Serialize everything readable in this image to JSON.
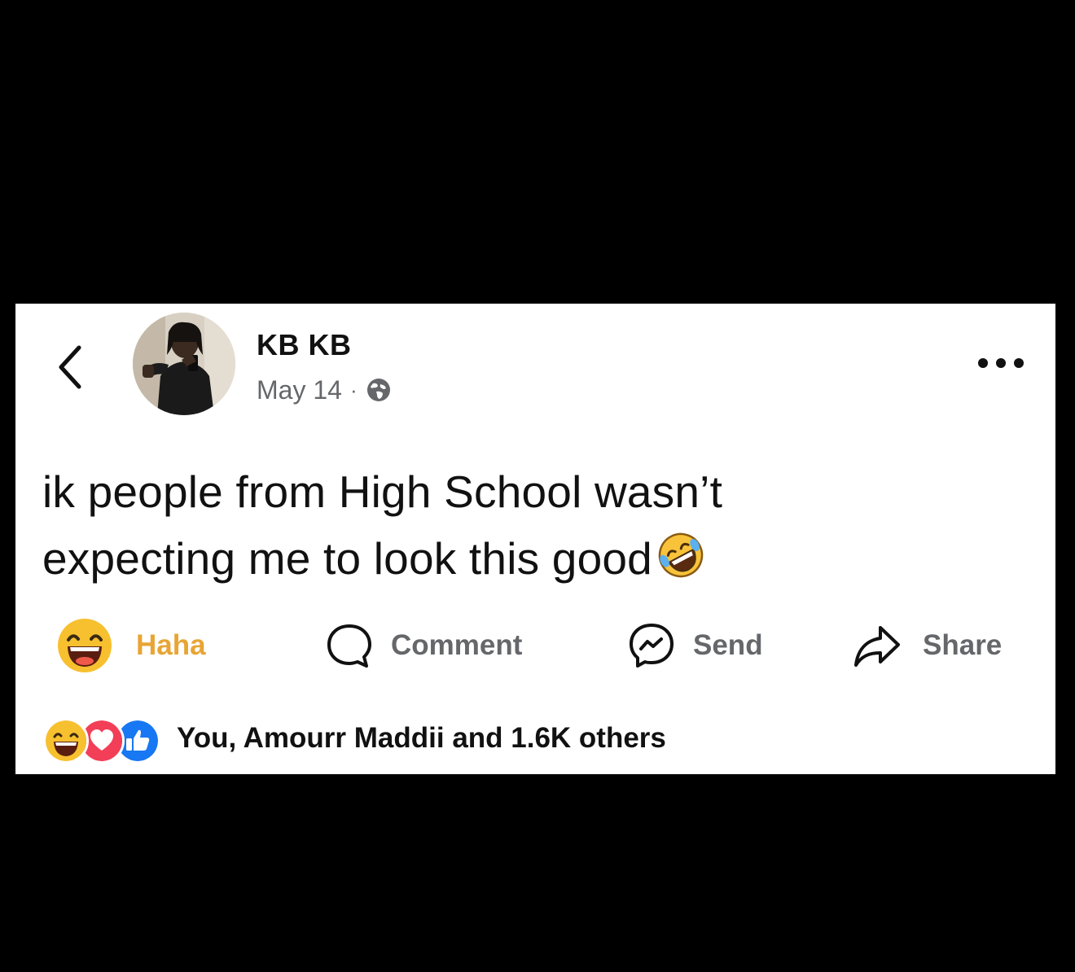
{
  "post": {
    "author_name": "KB KB",
    "date": "May 14",
    "separator": "·",
    "body_line1": "ik people from High School wasn’t",
    "body_line2": "expecting me to look this good"
  },
  "actions": {
    "haha_label": "Haha",
    "comment_label": "Comment",
    "send_label": "Send",
    "share_label": "Share"
  },
  "reactions": {
    "summary": "You, Amourr Maddii and 1.6K others"
  },
  "icons": {
    "back": "chevron-left-icon",
    "globe": "globe-icon",
    "more": "more-icon",
    "haha": "haha-reaction-icon",
    "comment": "comment-icon",
    "send": "messenger-icon",
    "share": "share-icon",
    "laugh": "rolling-laugh-emoji",
    "love": "love-reaction-icon",
    "like": "like-reaction-icon"
  },
  "colors": {
    "page_background": "#000000",
    "card_background": "#ffffff",
    "text_primary": "#111111",
    "text_secondary": "#65676b",
    "haha_yellow": "#e8a534",
    "love_red": "#f33e58",
    "like_blue": "#1877f2"
  }
}
